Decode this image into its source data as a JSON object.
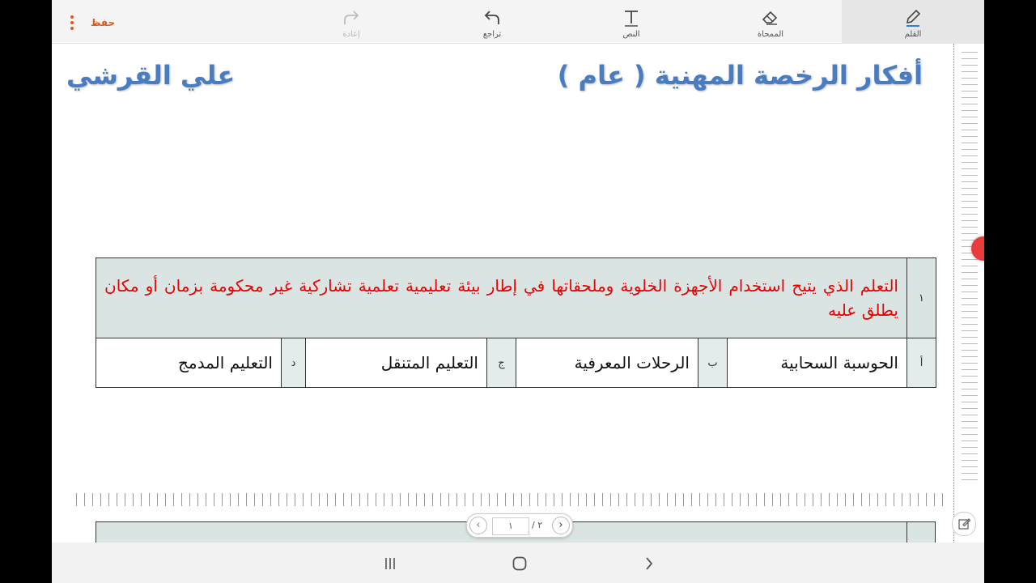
{
  "toolbar": {
    "pen_label": "القلم",
    "eraser_label": "الممحاة",
    "text_label": "النص",
    "undo_label": "تراجع",
    "redo_label": "إعادة",
    "save_label": "حفظ",
    "icons": {
      "pen": "pen-icon",
      "eraser": "eraser-icon",
      "text": "text-icon",
      "undo": "undo-icon",
      "redo": "redo-icon",
      "more": "more-vertical-icon"
    },
    "accent_color": "#e2571e"
  },
  "document": {
    "title": "أفكار الرخصة المهنية ( عام )",
    "author": "علي القرشي",
    "heading_color": "#4a7cc0",
    "question": {
      "number": "١",
      "text": "التعلم الذي يتيح استخدام الأجهزة الخلوية وملحقاتها في إطار بيئة تعليمية تعلمية تشاركية غير محكومة بزمان أو مكان يطلق عليه",
      "text_color": "#e00000",
      "options": [
        {
          "letter": "أ",
          "text": "الحوسبة السحابية"
        },
        {
          "letter": "ب",
          "text": "الرحلات المعرفية"
        },
        {
          "letter": "ج",
          "text": "التعليم المتنقل"
        },
        {
          "letter": "د",
          "text": "التعليم المدمج"
        }
      ]
    }
  },
  "page_nav": {
    "current": "١",
    "total": "/ ٢",
    "prev_icon": "chevron-left-icon",
    "next_icon": "chevron-right-icon"
  },
  "system_nav": {
    "recent_icon": "recent-apps-icon",
    "home_icon": "home-icon",
    "back_icon": "back-icon"
  }
}
